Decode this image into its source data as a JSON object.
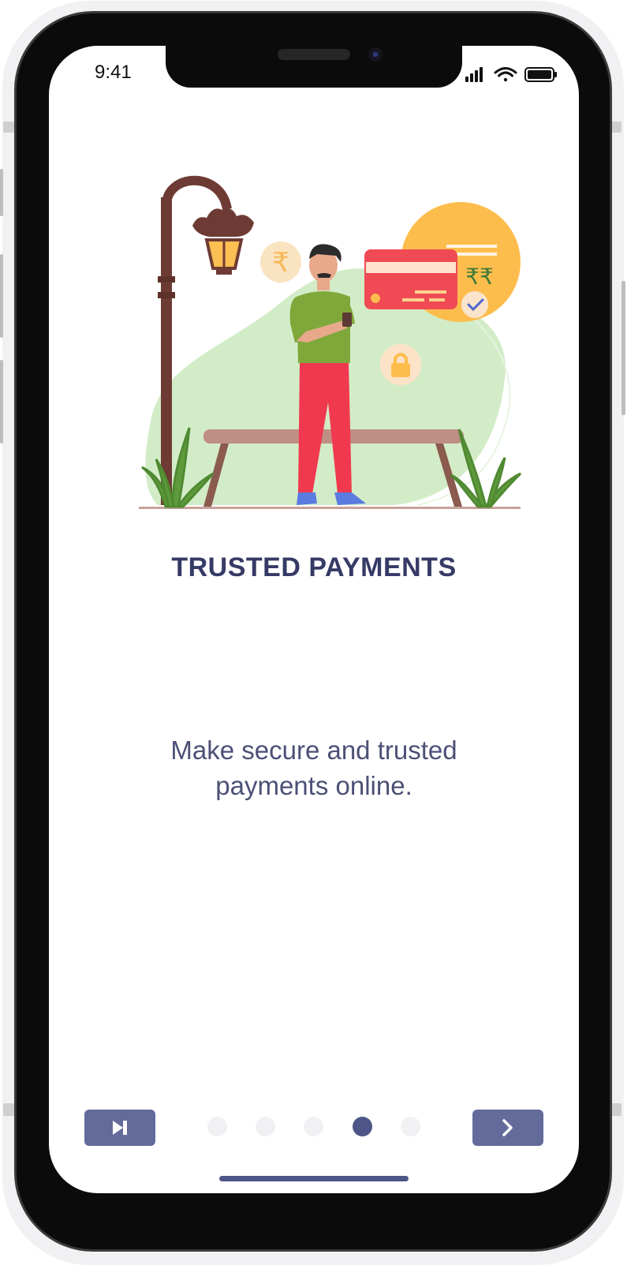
{
  "status_bar": {
    "time": "9:41",
    "icons": [
      "cellular-signal-icon",
      "wifi-icon",
      "battery-icon"
    ]
  },
  "onboarding": {
    "title": "TRUSTED PAYMENTS",
    "description": "Make secure and trusted payments online.",
    "illustration": {
      "currency_symbol": "₹",
      "card_currency": "₹₹"
    },
    "pagination": {
      "total": 5,
      "active_index": 3
    }
  },
  "buttons": {
    "skip_icon": "skip-to-end-icon",
    "next_icon": "chevron-right-icon"
  },
  "colors": {
    "accent": "#636b9b",
    "active_dot": "#4e5588",
    "inactive_dot": "#f1f1f4",
    "title": "#363a66",
    "description": "#4c5076",
    "card_red": "#f04a55",
    "coin_orange": "#fdbd4c",
    "blob_green": "#d3ecc8"
  }
}
